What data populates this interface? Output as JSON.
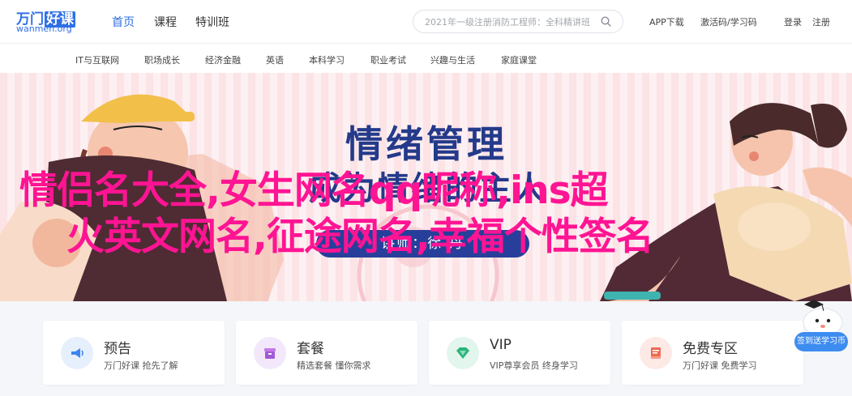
{
  "logo": {
    "cn_main": "万门",
    "cn_highlight": "好课",
    "en": "wanmen.org"
  },
  "nav": [
    {
      "label": "首页",
      "active": true
    },
    {
      "label": "课程",
      "active": false
    },
    {
      "label": "特训班",
      "active": false
    }
  ],
  "search": {
    "placeholder": "2021年一级注册消防工程师：全科精讲班"
  },
  "top_links": {
    "app": "APP下载",
    "activate": "激活码/学习码",
    "login": "登录",
    "register": "注册"
  },
  "categories": [
    "IT与互联网",
    "职场成长",
    "经济金融",
    "英语",
    "本科学习",
    "职业考试",
    "兴趣与生活",
    "家庭课堂"
  ],
  "banner": {
    "title": "情绪管理",
    "subtitle": "成为情绪的主人",
    "lecturer": "讲师：徐 丹",
    "overlay_line1": "情侣名大全,女生网名qq昵称,ins超",
    "overlay_line2": "火英文网名,征途网名,幸福个性签名"
  },
  "features": [
    {
      "title": "预告",
      "sub": "万门好课 抢先了解",
      "icon": "megaphone-icon",
      "color": "#3d86f0",
      "bg": "#e6f0fd"
    },
    {
      "title": "套餐",
      "sub": "精选套餐 懂你需求",
      "icon": "package-icon",
      "color": "#a05ad6",
      "bg": "#f3e8fb"
    },
    {
      "title": "VIP",
      "sub": "VIP尊享会员 终身学习",
      "icon": "diamond-icon",
      "color": "#2ab37a",
      "bg": "#e2f6ee"
    },
    {
      "title": "免费专区",
      "sub": "万门好课 免费学习",
      "icon": "book-icon",
      "color": "#f06a52",
      "bg": "#fde9e5"
    }
  ],
  "signin": {
    "label": "签到送学习币"
  },
  "colors": {
    "brand": "#2f6fe6",
    "overlay": "#ff1493",
    "banner_navy": "#243a8a"
  }
}
